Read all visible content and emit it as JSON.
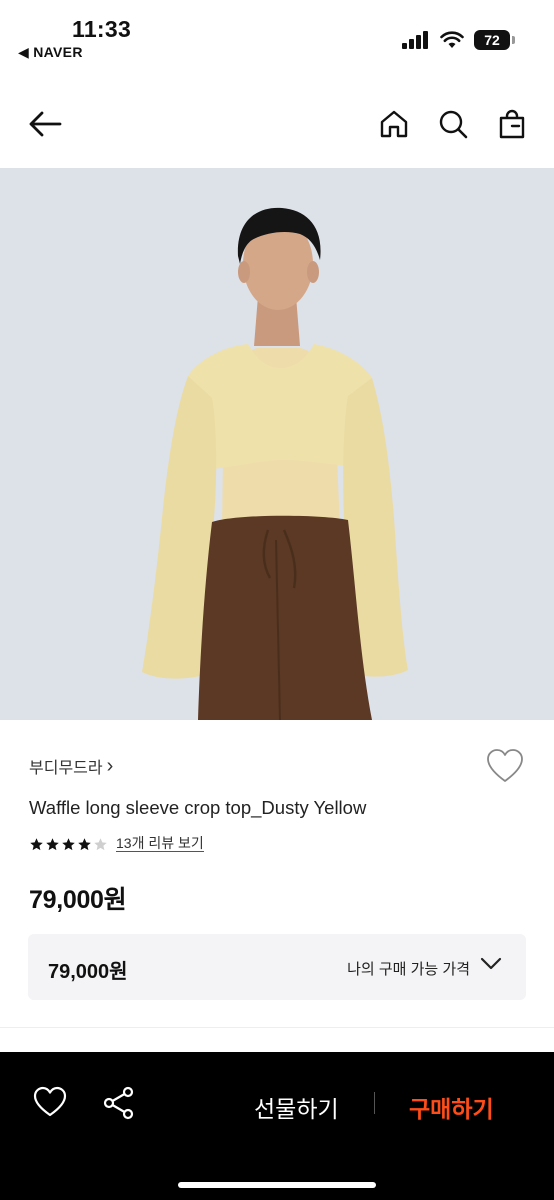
{
  "status_bar": {
    "time": "11:33",
    "back_app": "◀ NAVER",
    "battery": "72",
    "icons": [
      "signal-icon",
      "wifi-icon",
      "battery-icon"
    ]
  },
  "nav": {
    "icons": [
      "back-arrow-icon",
      "home-icon",
      "search-icon",
      "shopping-bag-icon"
    ]
  },
  "product": {
    "image_icon": "product-photo",
    "brand": "부디무드라",
    "brand_chevron": "›",
    "name": "Waffle long sleeve crop top_Dusty Yellow",
    "rating": 4,
    "rating_max": 5,
    "review_link": "13개 리뷰 보기",
    "price": "79,000원"
  },
  "price_box": {
    "price": "79,000원",
    "label": "나의 구매 가능 가격"
  },
  "bottom_bar": {
    "gift_label": "선물하기",
    "buy_label": "구매하기",
    "icons": [
      "heart-icon",
      "share-icon"
    ]
  },
  "colors": {
    "accent": "#ff4d1a",
    "bottom_bar": "#000000",
    "image_bg": "#dde1e8",
    "price_box_bg": "#f4f4f6"
  }
}
